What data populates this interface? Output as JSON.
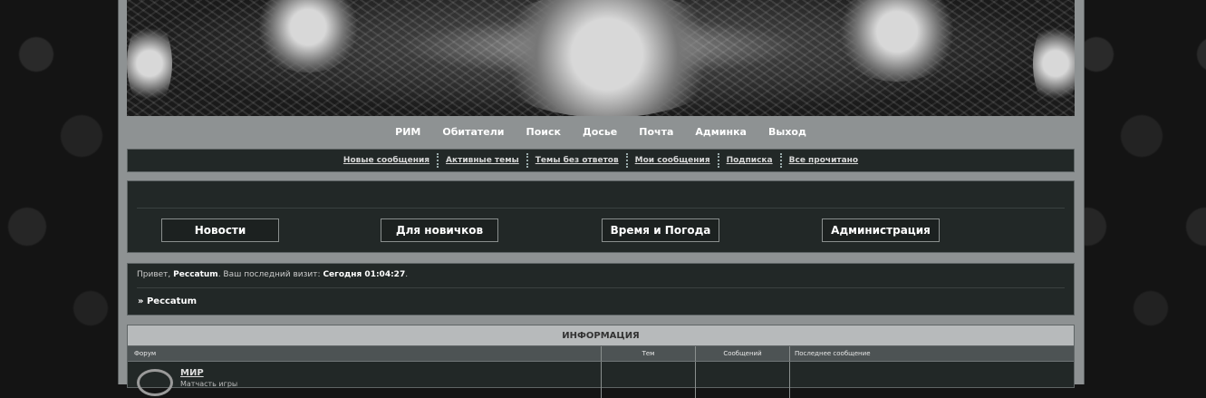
{
  "main_nav": [
    "РИМ",
    "Обитатели",
    "Поиск",
    "Досье",
    "Почта",
    "Админка",
    "Выход"
  ],
  "sub_nav": [
    "Новые сообщения",
    "Активные темы",
    "Темы без ответов",
    "Мои сообщения",
    "Подписка",
    "Все прочитано"
  ],
  "quick_links": [
    "Новости",
    "Для новичков",
    "Время и Погода",
    "Администрация"
  ],
  "welcome": {
    "greeting": "Привет,",
    "username": "Peccatum",
    "last_visit_label": ". Ваш последний визит:",
    "last_visit_value": "Сегодня 01:04:27",
    "dot": ".",
    "crumb_prefix": "»",
    "crumb": "Peccatum"
  },
  "forum": {
    "category": "ИНФОРМАЦИЯ",
    "columns": [
      "Форум",
      "Тем",
      "Сообщений",
      "Последнее сообщение"
    ],
    "rows": [
      {
        "title": "МИР",
        "desc": "Матчасть игры"
      }
    ]
  }
}
